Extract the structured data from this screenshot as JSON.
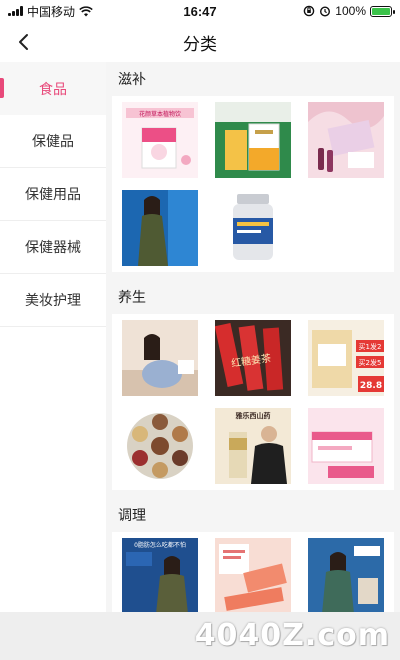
{
  "status_bar": {
    "carrier": "中国移动",
    "time": "16:47",
    "battery": "100%"
  },
  "header": {
    "title": "分类"
  },
  "sidebar": {
    "items": [
      {
        "label": "食品",
        "active": true
      },
      {
        "label": "保健品",
        "active": false
      },
      {
        "label": "保健用品",
        "active": false
      },
      {
        "label": "保健器械",
        "active": false
      },
      {
        "label": "美妆护理",
        "active": false
      }
    ]
  },
  "sections": [
    {
      "title": "滋补",
      "products": [
        "pink-gift-box",
        "golden-health-box",
        "pink-beauty-drink",
        "woman-green-dress",
        "supplement-bottle"
      ]
    },
    {
      "title": "养生",
      "products": [
        "pregnant-woman",
        "red-date-sticks",
        "herbal-tea-bag",
        "grain-bowls",
        "man-with-product",
        "pink-product-box"
      ]
    },
    {
      "title": "调理",
      "products": [
        "woman-promo-1",
        "women-product-pack",
        "woman-promo-2"
      ]
    }
  ],
  "product_text": {
    "pink_gift_label": "花颜草本植物饮",
    "date_tea": "红糖姜茶",
    "promo_1": "买1发2",
    "promo_2": "买2发5",
    "price": "28.8",
    "brand_banner": "雅乐西山药",
    "promo_headline": "0脂肪怎么吃都不怕"
  },
  "watermark": "4040Z.com",
  "colors": {
    "accent": "#e8497a",
    "sidebar_active_bg": "#f7f7f7",
    "content_bg": "#f5f5f5"
  }
}
